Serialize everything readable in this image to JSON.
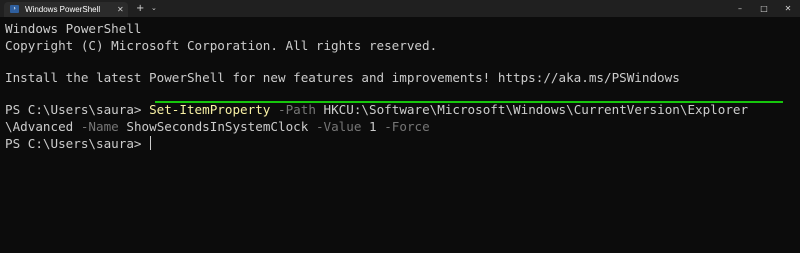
{
  "window": {
    "tab_title": "Windows PowerShell",
    "tab_icon": "powershell-icon",
    "close_tab_glyph": "✕",
    "new_tab_glyph": "+",
    "dropdown_glyph": "⌄",
    "minimize_glyph": "–",
    "maximize_glyph": "□",
    "close_glyph": "✕"
  },
  "terminal": {
    "header_line_1": "Windows PowerShell",
    "header_line_2": "Copyright (C) Microsoft Corporation. All rights reserved.",
    "install_message": "Install the latest PowerShell for new features and improvements! https://aka.ms/PSWindows",
    "prompt": "PS C:\\Users\\saura> ",
    "command": {
      "cmdlet": "Set-ItemProperty",
      "path_param": "-Path",
      "path_value_part1": "HKCU:\\Software\\Microsoft\\Windows\\CurrentVersion\\Explorer",
      "path_value_part2": "\\Advanced",
      "name_param": "-Name",
      "name_value": "ShowSecondsInSystemClock",
      "value_param": "-Value",
      "value_value": "1",
      "force_param": "-Force"
    },
    "second_prompt": "PS C:\\Users\\saura> "
  },
  "colors": {
    "background": "#0c0c0c",
    "text": "#cccccc",
    "cmdlet": "#f9f1a5",
    "parameter": "#767676",
    "highlight_underline": "#16c60c"
  }
}
